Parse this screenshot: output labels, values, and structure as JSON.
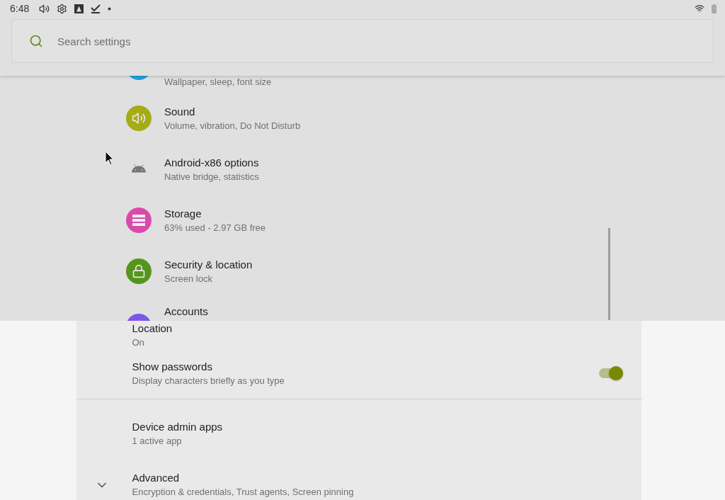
{
  "status_bar": {
    "time": "6:48"
  },
  "search": {
    "placeholder": "Search settings"
  },
  "settings_list": [
    {
      "subtitle": "Wallpaper, sleep, font size",
      "color": "#1ea3dc"
    },
    {
      "title": "Sound",
      "subtitle": "Volume, vibration, Do Not Disturb",
      "color": "#a6ac16"
    },
    {
      "title": "Android-x86 options",
      "subtitle": "Native bridge, statistics"
    },
    {
      "title": "Storage",
      "subtitle": "63% used - 2.97 GB free",
      "color": "#d94bab"
    },
    {
      "title": "Security & location",
      "subtitle": "Screen lock",
      "color": "#55951c"
    },
    {
      "title": "Accounts",
      "color": "#7e57e2"
    }
  ],
  "security_page": {
    "sections": [
      [
        {
          "kind": "plain",
          "title": "Location",
          "subtitle": "On"
        },
        {
          "kind": "switch",
          "title": "Show passwords",
          "subtitle": "Display characters briefly as you type",
          "on": true
        }
      ],
      [
        {
          "kind": "plain",
          "title": "Device admin apps",
          "subtitle": "1 active app"
        },
        {
          "kind": "expander",
          "title": "Advanced",
          "subtitle": "Encryption & credentials, Trust agents, Screen pinning",
          "expanded": false
        }
      ]
    ]
  }
}
